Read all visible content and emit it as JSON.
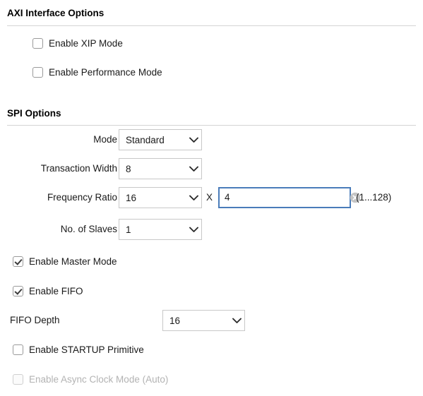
{
  "sections": [
    {
      "title": "AXI Interface Options"
    },
    {
      "title": "SPI Options"
    }
  ],
  "axi_options": {
    "checkboxes": [
      {
        "label": "Enable XIP Mode",
        "checked": false,
        "disabled": false
      },
      {
        "label": "Enable Performance Mode",
        "checked": false,
        "disabled": false
      }
    ]
  },
  "spi_options": {
    "mode": {
      "label": "Mode",
      "value": "Standard"
    },
    "transaction_width": {
      "label": "Transaction Width",
      "value": "8"
    },
    "frequency_ratio": {
      "label": "Frequency Ratio",
      "value": "16",
      "multiplier_symbol": "X",
      "factor_value": "4",
      "range_hint": "(1...128)",
      "clear_icon": "clear-circle-icon"
    },
    "no_of_slaves": {
      "label": "No. of Slaves",
      "value": "1"
    },
    "fifo_depth": {
      "label": "FIFO Depth",
      "value": "16"
    },
    "checkboxes": [
      {
        "label": "Enable Master Mode",
        "checked": true,
        "disabled": false
      },
      {
        "label": "Enable FIFO",
        "checked": true,
        "disabled": false
      },
      {
        "label": "Enable STARTUP Primitive",
        "checked": false,
        "disabled": false
      },
      {
        "label": "Enable Async Clock Mode (Auto)",
        "checked": false,
        "disabled": true
      }
    ]
  },
  "colors": {
    "focus_border": "#4a7cba",
    "rule": "#d4d4d4",
    "combo_border": "#c8c8c8",
    "disabled_text": "#b3b3b3"
  },
  "icons": {
    "chevron_down": "chevron-down-icon"
  }
}
